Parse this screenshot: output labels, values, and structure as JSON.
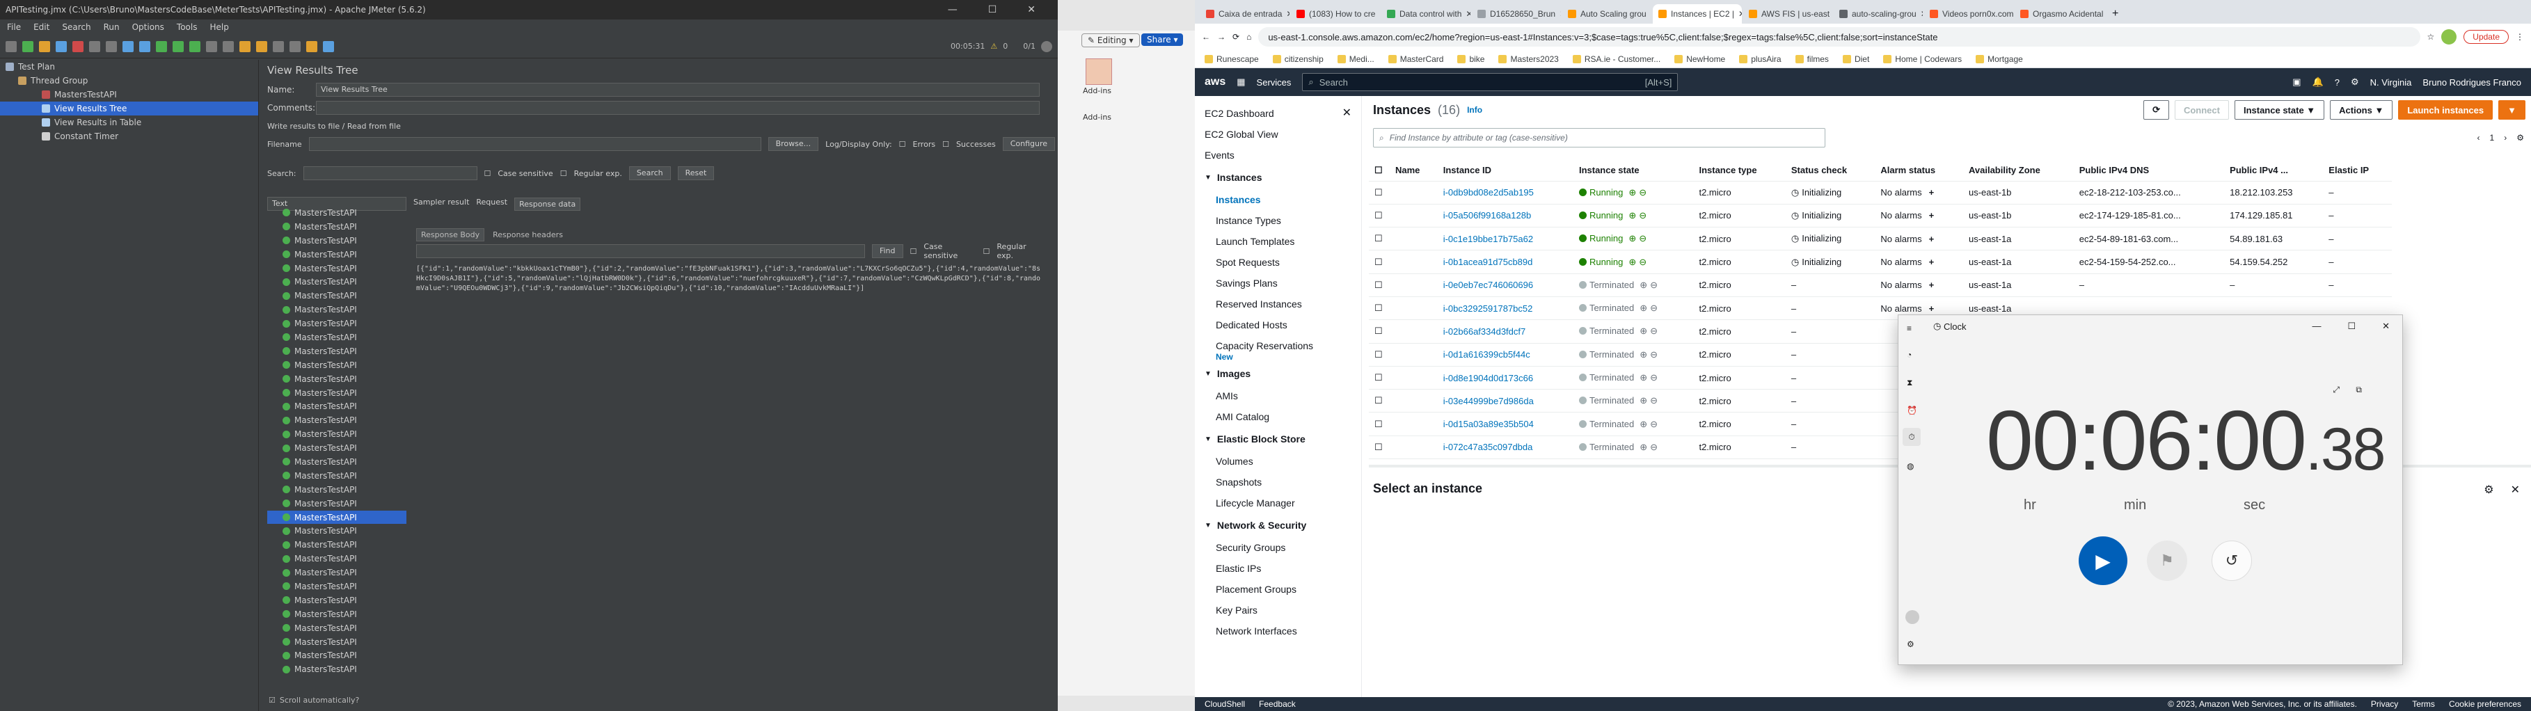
{
  "jmeter": {
    "title": "APITesting.jmx (C:\\Users\\Bruno\\MastersCodeBase\\MeterTests\\APITesting.jmx) - Apache JMeter (5.6.2)",
    "menu": [
      "File",
      "Edit",
      "Search",
      "Run",
      "Options",
      "Tools",
      "Help"
    ],
    "timer": "00:05:31",
    "warn": "0",
    "threads": "0/1",
    "tree": {
      "plan": "Test Plan",
      "group": "Thread Group",
      "sampler": "MastersTestAPI",
      "vrt": "View Results Tree",
      "vrtable": "View Results in Table",
      "ctimer": "Constant Timer"
    },
    "panel_title": "View Results Tree",
    "name_label": "Name:",
    "name_value": "View Results Tree",
    "comments_label": "Comments:",
    "write_label": "Write results to file / Read from file",
    "filename_label": "Filename",
    "browse": "Browse...",
    "log_only": "Log/Display Only:",
    "errors": "Errors",
    "successes": "Successes",
    "configure": "Configure",
    "search_label": "Search:",
    "case_sensitive": "Case sensitive",
    "regex": "Regular exp.",
    "search_btn": "Search",
    "reset_btn": "Reset",
    "renderer": "Text",
    "tabs": [
      "Sampler result",
      "Request",
      "Response data"
    ],
    "subtabs": [
      "Response Body",
      "Response headers"
    ],
    "find": "Find",
    "body": "[{\"id\":1,\"randomValue\":\"kbkkUoax1cTYmB0\"},{\"id\":2,\"randomValue\":\"fE3pbNFuak1SFK1\"},{\"id\":3,\"randomValue\":\"L7KXCrSo6qOCZu5\"},{\"id\":4,\"randomValue\":\"8sHkcI9D0sAJB1I\"},{\"id\":5,\"randomValue\":\"lQjHatbRW0D0k\"},{\"id\":6,\"randomValue\":\"nuefohrcgkuuxeR\"},{\"id\":7,\"randomValue\":\"CzWQwKLpGdRCD\"},{\"id\":8,\"randomValue\":\"U9QEOu0WDWCj3\"},{\"id\":9,\"randomValue\":\"Jb2CWsiQpQiqDu\"},{\"id\":10,\"randomValue\":\"IAcdduUvkMRaaLI\"}]",
    "results_count": 34,
    "scroll_auto": "Scroll automatically?"
  },
  "excel": {
    "editing": "Editing",
    "share": "Share",
    "addins": "Add-ins",
    "addins2": "Add-ins"
  },
  "browser": {
    "tabs": [
      "Caixa de entrada",
      "(1083) How to cre",
      "Data control with",
      "D16528650_Brun",
      "Auto Scaling grou",
      "Instances | EC2 |",
      "AWS FIS | us-east",
      "auto-scaling-grou",
      "Videos porn0x.com",
      "Orgasmo Acidental"
    ],
    "url": "us-east-1.console.aws.amazon.com/ec2/home?region=us-east-1#Instances:v=3;$case=tags:true%5C,client:false;$regex=tags:false%5C,client:false;sort=instanceState",
    "update": "Update",
    "bookmarks": [
      "Runescape",
      "citizenship",
      "Medi...",
      "MasterCard",
      "bike",
      "Masters2023",
      "RSA.ie - Customer...",
      "NewHome",
      "plusAira",
      "filmes",
      "Diet",
      "Home | Codewars",
      "Mortgage"
    ]
  },
  "aws": {
    "services": "Services",
    "search": "Search",
    "shortcut": "[Alt+S]",
    "region": "N. Virginia",
    "user": "Bruno Rodrigues Franco",
    "side": {
      "top": [
        "EC2 Dashboard",
        "EC2 Global View",
        "Events"
      ],
      "instances_h": "Instances",
      "instances": [
        "Instances",
        "Instance Types",
        "Launch Templates",
        "Spot Requests",
        "Savings Plans",
        "Reserved Instances",
        "Dedicated Hosts",
        "Capacity Reservations"
      ],
      "new": "New",
      "images_h": "Images",
      "images": [
        "AMIs",
        "AMI Catalog"
      ],
      "ebs_h": "Elastic Block Store",
      "ebs": [
        "Volumes",
        "Snapshots",
        "Lifecycle Manager"
      ],
      "net_h": "Network & Security",
      "net": [
        "Security Groups",
        "Elastic IPs",
        "Placement Groups",
        "Key Pairs",
        "Network Interfaces"
      ]
    },
    "heading": "Instances",
    "count": "(16)",
    "info": "Info",
    "connect": "Connect",
    "state": "Instance state",
    "actions": "Actions",
    "launch": "Launch instances",
    "find_ph": "Find Instance by attribute or tag (case-sensitive)",
    "page": "1",
    "cols": [
      "Name",
      "Instance ID",
      "Instance state",
      "Instance type",
      "Status check",
      "Alarm status",
      "Availability Zone",
      "Public IPv4 DNS",
      "Public IPv4 ...",
      "Elastic IP"
    ],
    "rows": [
      [
        "",
        "i-0db9bd08e2d5ab195",
        "Running",
        "t2.micro",
        "Initializing",
        "No alarms",
        "us-east-1b",
        "ec2-18-212-103-253.co...",
        "18.212.103.253",
        "–"
      ],
      [
        "",
        "i-05a506f99168a128b",
        "Running",
        "t2.micro",
        "Initializing",
        "No alarms",
        "us-east-1b",
        "ec2-174-129-185-81.co...",
        "174.129.185.81",
        "–"
      ],
      [
        "",
        "i-0c1e19bbe17b75a62",
        "Running",
        "t2.micro",
        "Initializing",
        "No alarms",
        "us-east-1a",
        "ec2-54-89-181-63.com...",
        "54.89.181.63",
        "–"
      ],
      [
        "",
        "i-0b1acea91d75cb89d",
        "Running",
        "t2.micro",
        "Initializing",
        "No alarms",
        "us-east-1a",
        "ec2-54-159-54-252.co...",
        "54.159.54.252",
        "–"
      ],
      [
        "",
        "i-0e0eb7ec746060696",
        "Terminated",
        "t2.micro",
        "–",
        "No alarms",
        "us-east-1a",
        "–",
        "–",
        "–"
      ],
      [
        "",
        "i-0bc3292591787bc52",
        "Terminated",
        "t2.micro",
        "–",
        "No alarms",
        "us-east-1a",
        "",
        "",
        ""
      ],
      [
        "",
        "i-02b66af334d3fdcf7",
        "Terminated",
        "t2.micro",
        "–",
        "",
        "",
        "",
        "",
        ""
      ],
      [
        "",
        "i-0d1a616399cb5f44c",
        "Terminated",
        "t2.micro",
        "–",
        "",
        "",
        "",
        "",
        ""
      ],
      [
        "",
        "i-0d8e1904d0d173c66",
        "Terminated",
        "t2.micro",
        "–",
        "",
        "",
        "",
        "",
        ""
      ],
      [
        "",
        "i-03e44999be7d986da",
        "Terminated",
        "t2.micro",
        "–",
        "",
        "",
        "",
        "",
        ""
      ],
      [
        "",
        "i-0d15a03a89e35b504",
        "Terminated",
        "t2.micro",
        "–",
        "",
        "",
        "",
        "",
        ""
      ],
      [
        "",
        "i-072c47a35c097dbda",
        "Terminated",
        "t2.micro",
        "–",
        "",
        "",
        "",
        "",
        ""
      ]
    ],
    "select": "Select an instance",
    "footer": [
      "CloudShell",
      "Feedback"
    ],
    "copyright": "© 2023, Amazon Web Services, Inc. or its affiliates.",
    "privacy": "Privacy",
    "terms": "Terms",
    "cookies": "Cookie preferences"
  },
  "clock": {
    "title": "Clock",
    "h": "00",
    "m": "06",
    "s": "00",
    "frac": ".38",
    "lh": "hr",
    "lm": "min",
    "ls": "sec"
  }
}
